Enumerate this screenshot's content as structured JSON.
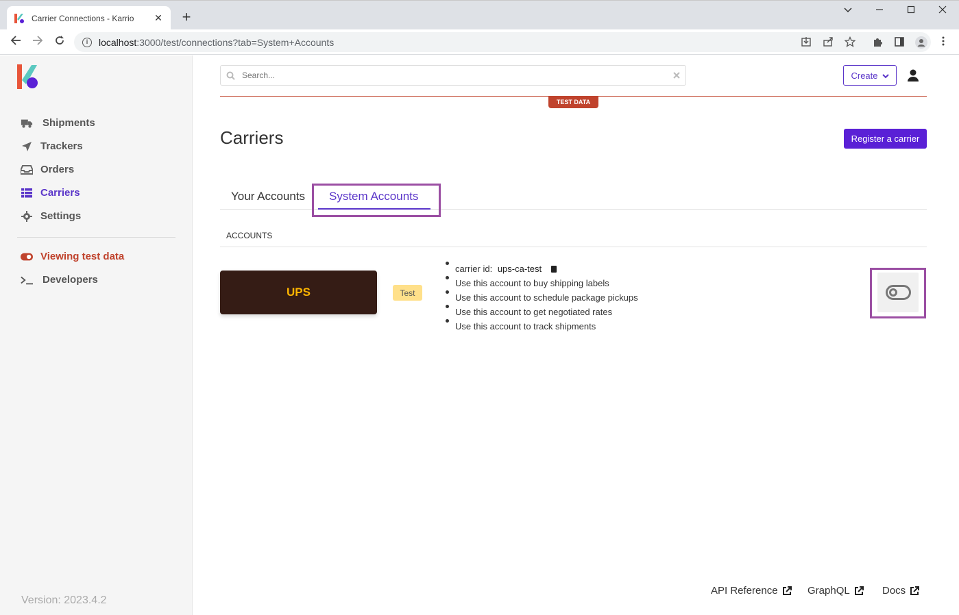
{
  "browser": {
    "tab_title": "Carrier Connections - Karrio",
    "tab_close": "✕",
    "new_tab": "+",
    "url_host": "localhost",
    "url_path": ":3000/test/connections?tab=System+Accounts"
  },
  "sidebar": {
    "items": [
      {
        "label": "Shipments",
        "icon": "truck-icon"
      },
      {
        "label": "Trackers",
        "icon": "paper-plane-icon"
      },
      {
        "label": "Orders",
        "icon": "inbox-icon"
      },
      {
        "label": "Carriers",
        "icon": "list-icon"
      },
      {
        "label": "Settings",
        "icon": "gear-icon"
      }
    ],
    "test_mode_label": "Viewing test data",
    "developers_label": "Developers",
    "version": "Version: 2023.4.2"
  },
  "header": {
    "search_placeholder": "Search...",
    "create_label": "Create",
    "test_badge": "TEST DATA"
  },
  "main": {
    "title": "Carriers",
    "register_label": "Register a carrier",
    "tabs": [
      {
        "label": "Your Accounts",
        "active": false
      },
      {
        "label": "System Accounts",
        "active": true
      }
    ],
    "accounts_header": "ACCOUNTS",
    "carrier": {
      "name": "UPS",
      "mode_tag": "Test",
      "carrier_id_label": "carrier id:",
      "carrier_id": "ups-ca-test",
      "capabilities": [
        "Use this account to buy shipping labels",
        "Use this account to schedule package pickups",
        "Use this account to get negotiated rates",
        "Use this account to track shipments"
      ],
      "enabled": false
    }
  },
  "footer": {
    "links": [
      "API Reference",
      "GraphQL",
      "Docs"
    ]
  },
  "colors": {
    "accent": "#5a35c9",
    "test": "#c0432d",
    "ups_brown": "#351c15",
    "ups_gold": "#ffb500",
    "highlight": "#9b4fa3"
  }
}
